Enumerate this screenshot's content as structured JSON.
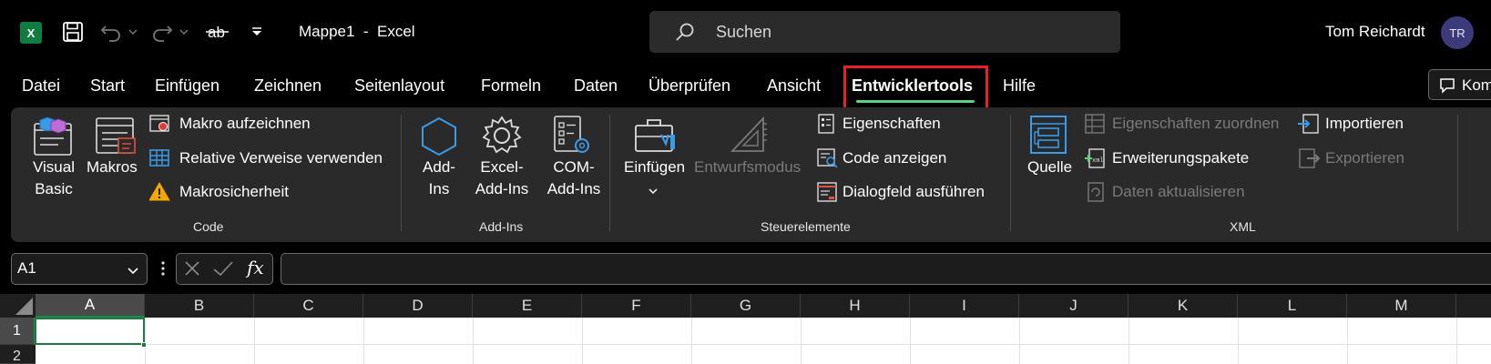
{
  "titlebar": {
    "app_icon": "excel-icon",
    "app_icon_letter": "X",
    "doc_title": "Mappe1  -  Excel",
    "search_placeholder": "Suchen",
    "user_name": "Tom Reichardt",
    "user_initials": "TR"
  },
  "tabs": [
    {
      "label": "Datei"
    },
    {
      "label": "Start"
    },
    {
      "label": "Einfügen"
    },
    {
      "label": "Zeichnen"
    },
    {
      "label": "Seitenlayout"
    },
    {
      "label": "Formeln"
    },
    {
      "label": "Daten"
    },
    {
      "label": "Überprüfen"
    },
    {
      "label": "Ansicht"
    },
    {
      "label": "Entwicklertools",
      "active": true
    },
    {
      "label": "Hilfe"
    }
  ],
  "comments_button": "Kom",
  "ribbon": {
    "code": {
      "label": "Code",
      "visual_basic": "Visual\nBasic",
      "macros": "Makros",
      "record_macro": "Makro aufzeichnen",
      "relative_refs": "Relative Verweise verwenden",
      "macro_security": "Makrosicherheit"
    },
    "addins": {
      "label": "Add-Ins",
      "addins": "Add-\nIns",
      "excel_addins": "Excel-\nAdd-Ins",
      "com_addins": "COM-\nAdd-Ins"
    },
    "controls": {
      "label": "Steuerelemente",
      "insert": "Einfügen",
      "design_mode": "Entwurfsmodus",
      "properties": "Eigenschaften",
      "view_code": "Code anzeigen",
      "run_dialog": "Dialogfeld ausführen"
    },
    "xml": {
      "label": "XML",
      "source": "Quelle",
      "map_properties": "Eigenschaften zuordnen",
      "expansion_packs": "Erweiterungspakete",
      "refresh_data": "Daten aktualisieren",
      "import": "Importieren",
      "export": "Exportieren"
    }
  },
  "formula_bar": {
    "name_box": "A1",
    "fx": "fx",
    "value": ""
  },
  "grid": {
    "columns": [
      "A",
      "B",
      "C",
      "D",
      "E",
      "F",
      "G",
      "H",
      "I",
      "J",
      "K",
      "L",
      "M"
    ],
    "rows": [
      "1",
      "2"
    ],
    "active_cell": "A1"
  },
  "colors": {
    "accent_green": "#5fd27c",
    "highlight_red": "#e8202a",
    "selection_green": "#1d7a45"
  }
}
